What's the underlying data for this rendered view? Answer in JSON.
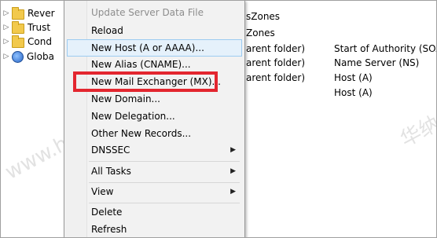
{
  "tree": {
    "items": [
      {
        "label": "Rever",
        "icon": "folder-icon"
      },
      {
        "label": "Trust",
        "icon": "folder-icon"
      },
      {
        "label": "Cond",
        "icon": "folder-icon"
      },
      {
        "label": "Globa",
        "icon": "global-logs-icon"
      }
    ]
  },
  "content": {
    "rows": [
      {
        "name": "sZones",
        "type": ""
      },
      {
        "name": "Zones",
        "type": ""
      },
      {
        "name": "arent folder)",
        "type": "Start of Authority (SOA)"
      },
      {
        "name": "arent folder)",
        "type": "Name Server (NS)"
      },
      {
        "name": "arent folder)",
        "type": "Host (A)"
      },
      {
        "name": "",
        "type": "Host (A)"
      }
    ]
  },
  "menu": {
    "items": [
      {
        "label": "Update Server Data File",
        "disabled": true
      },
      {
        "label": "Reload"
      },
      {
        "label": "New Host (A or AAAA)...",
        "hover": true
      },
      {
        "label": "New Alias (CNAME)..."
      },
      {
        "label": "New Mail Exchanger (MX)..."
      },
      {
        "label": "New Domain..."
      },
      {
        "label": "New Delegation..."
      },
      {
        "label": "Other New Records..."
      },
      {
        "label": "DNSSEC",
        "submenu": true
      },
      {
        "label": "All Tasks",
        "submenu": true
      },
      {
        "label": "View",
        "submenu": true
      },
      {
        "label": "Delete"
      },
      {
        "label": "Refresh"
      }
    ]
  },
  "watermark": {
    "left": "www.hncloud.com",
    "right": "华纳云"
  },
  "colors": {
    "highlight": "#e3262f",
    "hover_bg": "#e5f1fb",
    "hover_border": "#9ccbf1"
  }
}
